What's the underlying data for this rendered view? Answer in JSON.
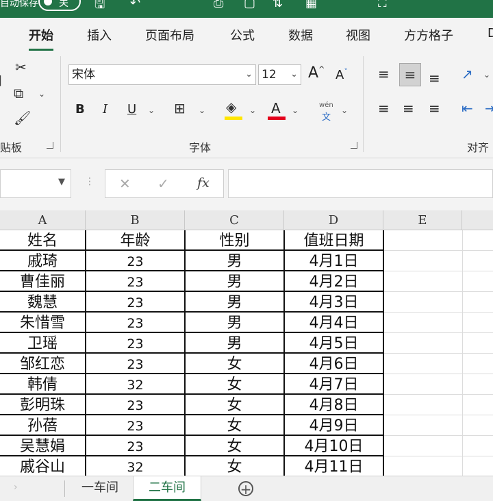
{
  "titlebar": {
    "autosave_label": "自动保存",
    "autosave_state": "关",
    "bg": "#217346"
  },
  "tabs": [
    "开始",
    "插入",
    "页面布局",
    "公式",
    "数据",
    "视图",
    "方方格子",
    "D"
  ],
  "active_tab": 0,
  "ribbon": {
    "font_name": "宋体",
    "font_size": "12",
    "grow_font": "A",
    "shrink_font": "A",
    "bold": "B",
    "italic": "I",
    "underline": "U",
    "font_color_glyph": "A",
    "phonetic_top": "wén",
    "phonetic_bottom": "文",
    "highlight_color": "#ffe600",
    "font_color": "#e3001b",
    "groups": {
      "clipboard": "贴板",
      "font": "字体",
      "alignment": "对齐"
    }
  },
  "formula_bar": {
    "fx_label": "fx",
    "value": ""
  },
  "sheet": {
    "columns": [
      "A",
      "B",
      "C",
      "D",
      "E"
    ],
    "header": [
      "姓名",
      "年龄",
      "性别",
      "值班日期"
    ],
    "rows": [
      [
        "戚琦",
        "23",
        "男",
        "4月1日"
      ],
      [
        "曹佳丽",
        "23",
        "男",
        "4月2日"
      ],
      [
        "魏慧",
        "23",
        "男",
        "4月3日"
      ],
      [
        "朱惜雪",
        "23",
        "男",
        "4月4日"
      ],
      [
        "卫瑶",
        "23",
        "男",
        "4月5日"
      ],
      [
        "邹红恋",
        "23",
        "女",
        "4月6日"
      ],
      [
        "韩倩",
        "32",
        "女",
        "4月7日"
      ],
      [
        "彭明珠",
        "23",
        "女",
        "4月8日"
      ],
      [
        "孙蓓",
        "23",
        "女",
        "4月9日"
      ],
      [
        "吴慧娟",
        "23",
        "女",
        "4月10日"
      ],
      [
        "戚谷山",
        "32",
        "女",
        "4月11日"
      ]
    ]
  },
  "sheet_tabs": [
    "一车间",
    "二车间"
  ],
  "active_sheet": 1,
  "icons": [
    "cut-icon",
    "copy-icon",
    "format-painter-icon",
    "border-icon",
    "fill-color-icon",
    "font-color-icon",
    "wrap-icon",
    "add-sheet-icon"
  ]
}
